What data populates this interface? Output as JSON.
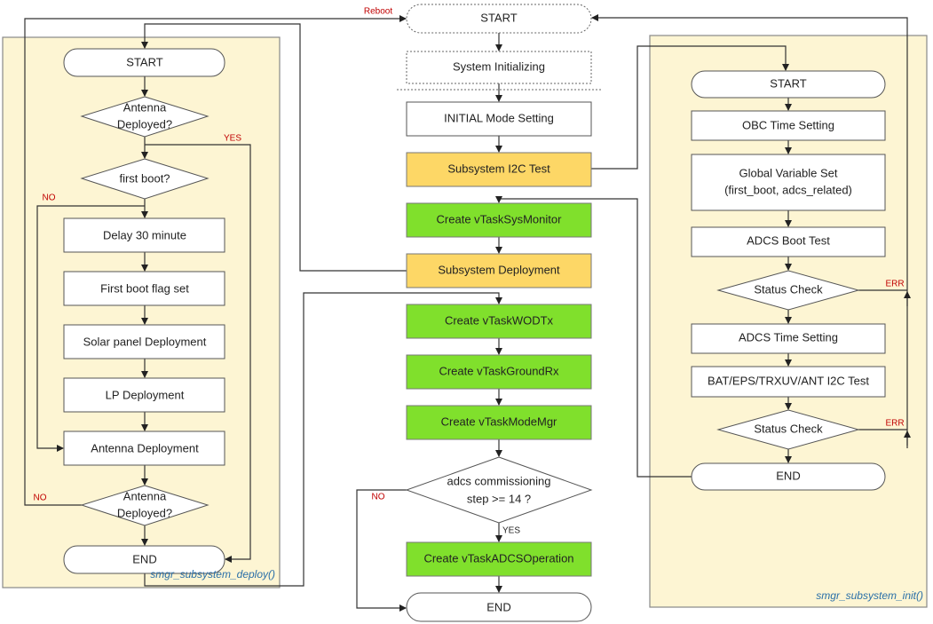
{
  "colors": {
    "panel": "#fdf5d3",
    "subsystem_box": "#fdd766",
    "task_box": "#80e02c",
    "branch_label": "#c00000",
    "caption": "#2a6fa8"
  },
  "main": {
    "start": "START",
    "system_init": "System Initializing",
    "initial_mode": "INITIAL Mode Setting",
    "i2c_test": "Subsystem I2C Test",
    "sysmonitor": "Create vTaskSysMonitor",
    "deployment": "Subsystem Deployment",
    "wodtx": "Create vTaskWODTx",
    "groundrx": "Create vTaskGroundRx",
    "modemgr": "Create vTaskModeMgr",
    "adcs_check_1": "adcs commissioning",
    "adcs_check_2": "step >= 14 ?",
    "yes": "YES",
    "no": "NO",
    "adcs_op": "Create vTaskADCSOperation",
    "end": "END",
    "reboot": "Reboot"
  },
  "deploy": {
    "caption": "smgr_subsystem_deploy()",
    "start": "START",
    "ant_dep_1": "Antenna",
    "ant_dep_2": "Deployed?",
    "yes": "YES",
    "first_boot": "first boot?",
    "no": "NO",
    "delay": "Delay 30 minute",
    "flag": "First boot flag set",
    "solar": "Solar panel Deployment",
    "lp": "LP Deployment",
    "antenna": "Antenna Deployment",
    "ant_dep2_1": "Antenna",
    "ant_dep2_2": "Deployed?",
    "no2": "NO",
    "end": "END"
  },
  "init": {
    "caption": "smgr_subsystem_init()",
    "start": "START",
    "obc_time": "OBC Time Setting",
    "global_1": "Global Variable Set",
    "global_2": "(first_boot, adcs_related)",
    "adcs_boot": "ADCS Boot Test",
    "status1": "Status Check",
    "err1": "ERR",
    "adcs_time": "ADCS Time Setting",
    "i2c": "BAT/EPS/TRXUV/ANT I2C Test",
    "status2": "Status Check",
    "err2": "ERR",
    "end": "END"
  }
}
